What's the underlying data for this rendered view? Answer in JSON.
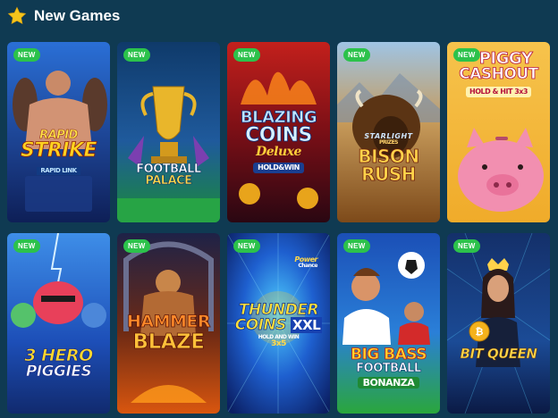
{
  "section": {
    "title": "New Games",
    "icon": "star-icon",
    "accent": "#f5c51b"
  },
  "badge_color": "#2cc24b",
  "games": [
    {
      "badge": "NEW",
      "line1": "RAPID",
      "line2": "STRIKE",
      "line3": "RAPID LINK"
    },
    {
      "badge": "NEW",
      "line1": "FOOTBALL",
      "line2": "PALACE"
    },
    {
      "badge": "NEW",
      "line1": "BLAZING",
      "line2": "COINS",
      "line3": "Deluxe",
      "line4": "HOLD&WIN"
    },
    {
      "badge": "NEW",
      "line1": "STARLIGHT",
      "line2": "PRIZES",
      "line3": "BISON",
      "line4": "RUSH"
    },
    {
      "badge": "NEW",
      "line1": "PIGGY",
      "line2": "CASHOUT",
      "line3": "HOLD & HIT 3x3"
    },
    {
      "badge": "NEW",
      "line1": "3 HERO",
      "line2": "PIGGIES"
    },
    {
      "badge": "NEW",
      "line1": "HAMMER",
      "line2": "BLAZE"
    },
    {
      "badge": "NEW",
      "line1": "Power",
      "line2": "Chance",
      "line3": "THUNDER",
      "line4": "COINS",
      "line5": "XXL",
      "line6": "HOLD AND WIN",
      "line7": "3x5"
    },
    {
      "badge": "NEW",
      "line1": "BIG BASS",
      "line2": "FOOTBALL",
      "line3": "BONANZA"
    },
    {
      "badge": "NEW",
      "line1": "BIT QUEEN"
    }
  ]
}
